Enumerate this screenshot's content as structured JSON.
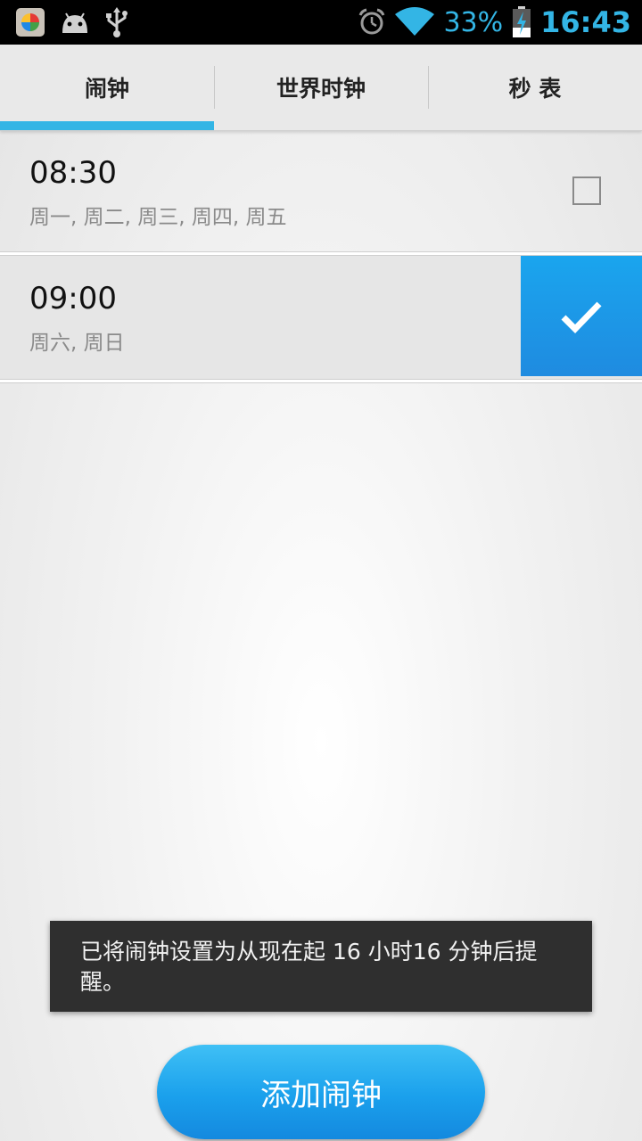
{
  "status_bar": {
    "battery": "33%",
    "time": "16:43",
    "icons": [
      "app-icon",
      "android-icon",
      "usb-icon",
      "alarm-clock-icon",
      "wifi-icon",
      "battery-charging-icon"
    ]
  },
  "tabs": [
    {
      "label": "闹钟",
      "selected": true
    },
    {
      "label": "世界时钟",
      "selected": false
    },
    {
      "label": "秒 表",
      "selected": false
    }
  ],
  "alarms": [
    {
      "time": "08:30",
      "days": "周一, 周二, 周三, 周四, 周五",
      "enabled": false
    },
    {
      "time": "09:00",
      "days": "周六, 周日",
      "enabled": true
    }
  ],
  "toast": {
    "message": "已将闹钟设置为从现在起 16 小时16 分钟后提醒。"
  },
  "add_button": {
    "label": "添加闹钟"
  },
  "colors": {
    "accent": "#33b5e5",
    "checked_bg": "#1a9bea",
    "toast_bg": "#2f2f2f"
  }
}
